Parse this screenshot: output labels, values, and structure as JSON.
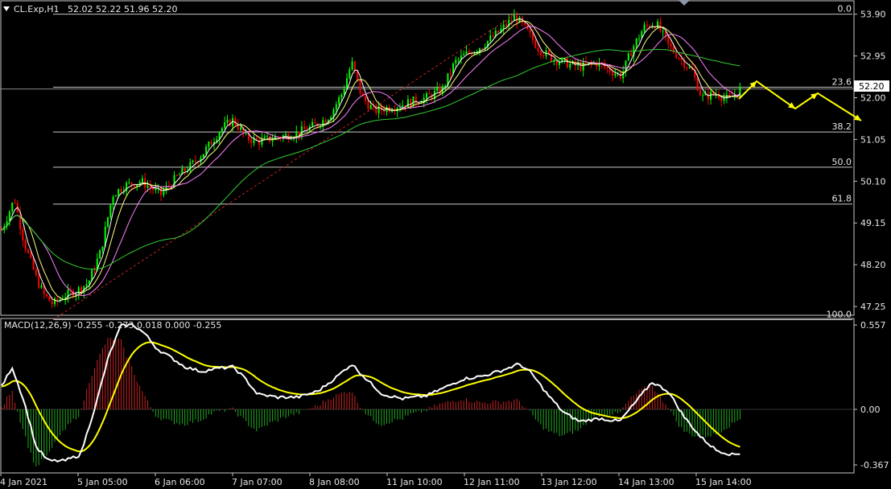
{
  "header": {
    "symbol": "CL.Exp,H1",
    "ohlc": "52.02 52.22 51.96 52.20",
    "menu_icon": "triangle-down-icon"
  },
  "macd_header": "MACD(12,26,9) -0.255 -0.273 0.018 0.000 -0.255",
  "price_badge": "52.20",
  "chart_data": [
    {
      "type": "candlestick",
      "title": "CL.Exp,H1",
      "y_ticks": [
        "53.90",
        "52.95",
        "52.00",
        "51.05",
        "50.10",
        "49.15",
        "48.20",
        "47.25"
      ],
      "ylim": [
        47.05,
        54.15
      ],
      "x_ticks": [
        "4 Jan 2021",
        "5 Jan 05:00",
        "6 Jan 06:00",
        "7 Jan 07:00",
        "8 Jan 08:00",
        "11 Jan 10:00",
        "12 Jan 11:00",
        "13 Jan 12:00",
        "14 Jan 13:00",
        "15 Jan 14:00"
      ],
      "last_price": 52.2,
      "fibonacci": [
        {
          "label": "0.0",
          "price": 53.9
        },
        {
          "label": "23.6",
          "price": 52.24
        },
        {
          "label": "38.2",
          "price": 51.22
        },
        {
          "label": "50.0",
          "price": 50.42
        },
        {
          "label": "61.8",
          "price": 49.58
        },
        {
          "label": "100.0",
          "price": 46.95
        }
      ],
      "colors": {
        "up": "#00ff00",
        "down": "#ff0000",
        "ma_fast": "#ffffff",
        "ma_mid": "#ffff80",
        "ma_slow": "#ff80ff",
        "ma_long": "#33cc33",
        "forecast": "#ffff00",
        "grid": "#c0c0c0"
      },
      "grid": false
    },
    {
      "type": "bar",
      "title": "MACD(12,26,9)",
      "y_ticks": [
        "0.557",
        "0.00",
        "-0.367"
      ],
      "ylim": [
        -0.42,
        0.6
      ],
      "values": {
        "main": -0.255,
        "signal": -0.273,
        "histogram": 0.018
      },
      "colors": {
        "macd": "#ffffff",
        "signal": "#ffff00",
        "hist_up": "#cc2222",
        "hist_down": "#22aa22"
      }
    }
  ]
}
